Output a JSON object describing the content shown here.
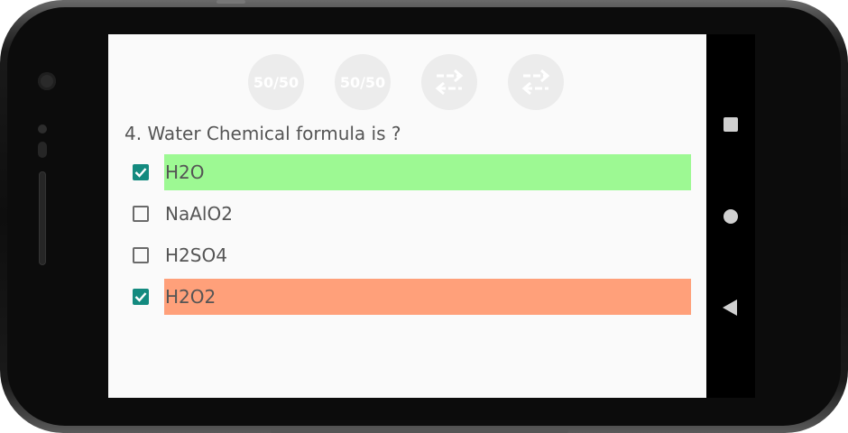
{
  "lifelines": [
    {
      "label": "50/50",
      "icon": "fifty-fifty-icon"
    },
    {
      "label": "50/50",
      "icon": "fifty-fifty-icon"
    },
    {
      "label": "",
      "icon": "swap-arrows-icon"
    },
    {
      "label": "",
      "icon": "swap-arrows-icon"
    }
  ],
  "question": {
    "text": "4. Water Chemical formula is ?"
  },
  "options": [
    {
      "label": "H2O",
      "checked": true,
      "highlight": "#9df993"
    },
    {
      "label": "NaAlO2",
      "checked": false,
      "highlight": ""
    },
    {
      "label": "H2SO4",
      "checked": false,
      "highlight": ""
    },
    {
      "label": "H2O2",
      "checked": true,
      "highlight": "#ffa07a"
    }
  ],
  "colors": {
    "checkbox_accent": "#138a7f",
    "correct": "#9df993",
    "wrong": "#ffa07a",
    "lifeline_bg": "#ececec"
  },
  "navbar": {
    "icons": [
      "recents-square-icon",
      "home-circle-icon",
      "back-triangle-icon"
    ]
  }
}
